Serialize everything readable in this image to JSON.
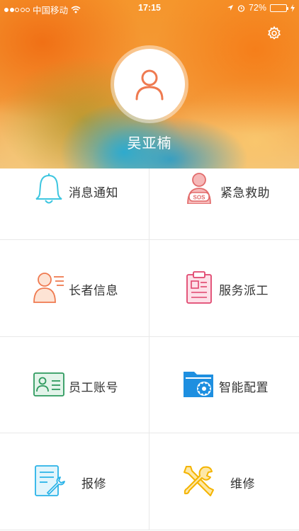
{
  "status": {
    "carrier": "中国移动",
    "time": "17:15",
    "battery": "72%",
    "battery_level": 0.72
  },
  "profile": {
    "name": "吴亚楠"
  },
  "menu": [
    {
      "label": "消息通知",
      "icon": "bell-icon",
      "color": "#3ec6e0"
    },
    {
      "label": "紧急救助",
      "icon": "sos-person-icon",
      "color": "#ef7f7f"
    },
    {
      "label": "长者信息",
      "icon": "elder-info-icon",
      "color": "#f07a50"
    },
    {
      "label": "服务派工",
      "icon": "clipboard-icon",
      "color": "#e0466e"
    },
    {
      "label": "员工账号",
      "icon": "id-card-icon",
      "color": "#2e9a5e"
    },
    {
      "label": "智能配置",
      "icon": "folder-gear-icon",
      "color": "#1e8fe0"
    },
    {
      "label": "报修",
      "icon": "repair-form-icon",
      "color": "#2ab3e8"
    },
    {
      "label": "维修",
      "icon": "tools-icon",
      "color": "#f4b400"
    }
  ]
}
